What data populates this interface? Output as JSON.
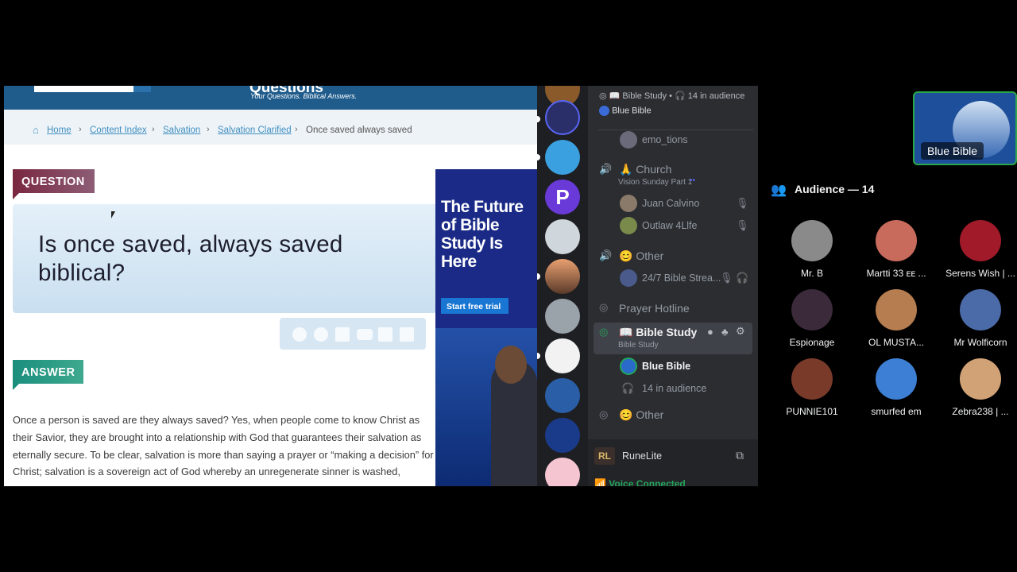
{
  "website": {
    "site_name": "Questions",
    "tagline": "Your Questions. Biblical Answers.",
    "breadcrumbs": [
      "Home",
      "Content Index",
      "Salvation",
      "Salvation Clarified"
    ],
    "breadcrumb_current": "Once saved always saved",
    "question_tag": "QUESTION",
    "question_title": "Is once saved, always saved biblical?",
    "answer_tag": "ANSWER",
    "answer_text": "Once a person is saved are they always saved? Yes, when people come to know Christ as their Savior, they are brought into a relationship with God that guarantees their salvation as eternally secure. To be clear, salvation is more than saying a prayer or “making a decision” for Christ; salvation is a sovereign act of God whereby an unregenerate sinner is washed,",
    "tool_icons": [
      "accessibility-icon",
      "podcast-icon",
      "comment-icon",
      "youtube-icon",
      "print-icon",
      "audio-icon"
    ],
    "ad_headline": "The Future of Bible Study Is Here",
    "ad_button": "Start free trial"
  },
  "discord": {
    "top_status": {
      "channel": "📖 Bible Study",
      "audience": "14 in audience",
      "speaker": "Blue Bible"
    },
    "top_user": "emo_tions",
    "channels": [
      {
        "name": "🙏 Church",
        "subtitle": "Vision Sunday Part 1",
        "users": [
          "Juan Calvino",
          "Outlaw 4Llfe"
        ]
      },
      {
        "name": "😊 Other",
        "users": [
          "24/7 Bible Strea..."
        ]
      },
      {
        "name": "Prayer Hotline"
      },
      {
        "name": "📖 Bible Study",
        "subtitle": "Bible Study",
        "users": [
          "Blue Bible",
          "14 in audience"
        ]
      },
      {
        "name": "😊 Other"
      }
    ],
    "app_status": "RuneLite",
    "voice_status": "Voice Connected"
  },
  "stage": {
    "speaker_tile": "Blue Bible",
    "audience_title": "Audience — 14",
    "audience": [
      {
        "name": "Mr. B",
        "color": "#8a8a8a"
      },
      {
        "name": "Martti 33 ᴇᴇ ...",
        "color": "#c86b5c"
      },
      {
        "name": "Serens Wish | ...",
        "color": "#a11a2a"
      },
      {
        "name": "Espionage",
        "color": "#3b2a3a"
      },
      {
        "name": "OL MUSTA...",
        "color": "#b57d50"
      },
      {
        "name": "Mr Wolficorn",
        "color": "#4a6aa8"
      },
      {
        "name": "PUNNIE101",
        "color": "#7a3a2a"
      },
      {
        "name": "smurfed em",
        "color": "#3d7fd4"
      },
      {
        "name": "Zebra238 | ...",
        "color": "#d2a277"
      }
    ]
  }
}
